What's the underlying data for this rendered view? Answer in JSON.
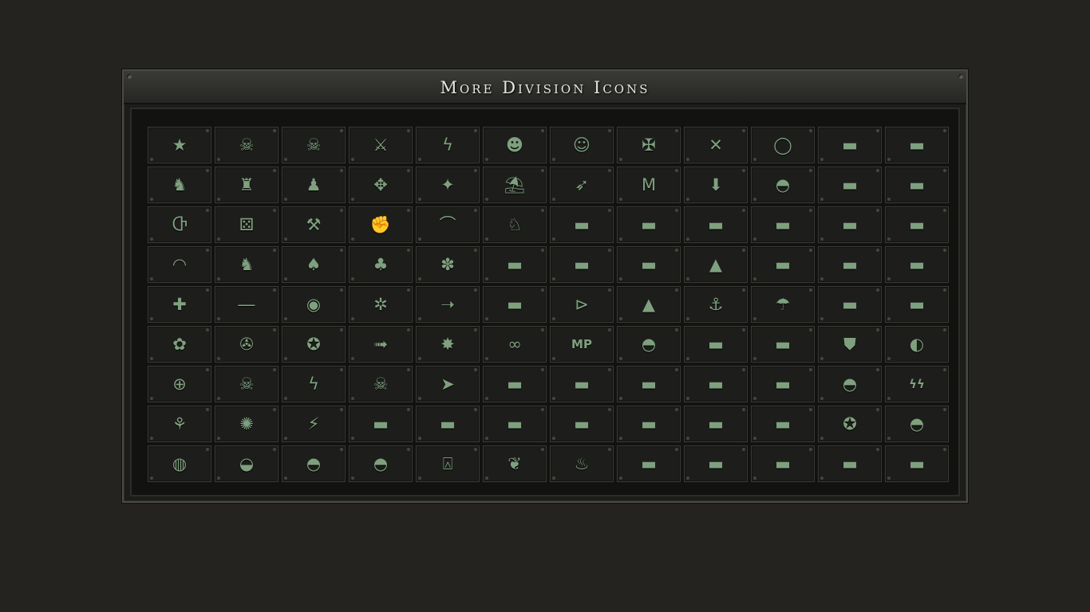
{
  "window": {
    "title": "More Division Icons"
  },
  "icons": [
    {
      "name": "star-icon",
      "g": "★"
    },
    {
      "name": "skull-icon",
      "g": "☠"
    },
    {
      "name": "winged-skull-icon",
      "g": "☠"
    },
    {
      "name": "crossed-rifles-icon",
      "g": "⚔"
    },
    {
      "name": "lightning-icon",
      "g": "ϟ"
    },
    {
      "name": "goblin-head-icon",
      "g": "☻"
    },
    {
      "name": "mask-icon",
      "g": "☺"
    },
    {
      "name": "winged-sword-icon",
      "g": "✠"
    },
    {
      "name": "crossed-swords-icon",
      "g": "✕"
    },
    {
      "name": "laurel-icon",
      "g": "◯"
    },
    {
      "name": "tank-icon",
      "g": "▬"
    },
    {
      "name": "tank-icon",
      "g": "▬"
    },
    {
      "name": "knight-piece-icon",
      "g": "♞"
    },
    {
      "name": "rook-piece-icon",
      "g": "♜"
    },
    {
      "name": "pawn-piece-icon",
      "g": "♟"
    },
    {
      "name": "compass-arrows-icon",
      "g": "✥"
    },
    {
      "name": "shuriken-star-icon",
      "g": "✦"
    },
    {
      "name": "palm-island-icon",
      "g": "⛱"
    },
    {
      "name": "bird-icon",
      "g": "➶"
    },
    {
      "name": "m-letter-icon",
      "g": "M"
    },
    {
      "name": "down-arrow-icon",
      "g": "⬇"
    },
    {
      "name": "helmet-icon",
      "g": "◓"
    },
    {
      "name": "heavy-tank-icon",
      "g": "▬"
    },
    {
      "name": "heavy-tank-icon",
      "g": "▬"
    },
    {
      "name": "rune-icon",
      "g": "Ⴇ"
    },
    {
      "name": "dice-icon",
      "g": "⚄"
    },
    {
      "name": "crossed-shovels-icon",
      "g": "⚒"
    },
    {
      "name": "fist-icon",
      "g": "✊"
    },
    {
      "name": "hook-icon",
      "g": "⌒"
    },
    {
      "name": "horse-icon",
      "g": "♘"
    },
    {
      "name": "truck-icon",
      "g": "▬"
    },
    {
      "name": "armored-car-icon",
      "g": "▬"
    },
    {
      "name": "light-tank-icon",
      "g": "▬"
    },
    {
      "name": "light-tank-icon",
      "g": "▬"
    },
    {
      "name": "heavy-tank-icon",
      "g": "▬"
    },
    {
      "name": "tank-icon",
      "g": "▬"
    },
    {
      "name": "rainbow-icon",
      "g": "◠"
    },
    {
      "name": "unicorn-icon",
      "g": "♞"
    },
    {
      "name": "spade-icon",
      "g": "♠"
    },
    {
      "name": "clover-icon",
      "g": "♣"
    },
    {
      "name": "paw-icon",
      "g": "✽"
    },
    {
      "name": "tank-icon",
      "g": "▬"
    },
    {
      "name": "heavy-tank-icon",
      "g": "▬"
    },
    {
      "name": "tank-icon",
      "g": "▬"
    },
    {
      "name": "anti-air-icon",
      "g": "▲"
    },
    {
      "name": "artillery-icon",
      "g": "▬"
    },
    {
      "name": "tank-icon",
      "g": "▬"
    },
    {
      "name": "tank-icon",
      "g": "▬"
    },
    {
      "name": "eagle-icon",
      "g": "✚"
    },
    {
      "name": "sword-icon",
      "g": "―"
    },
    {
      "name": "cat-head-icon",
      "g": "◉"
    },
    {
      "name": "wheel-icon",
      "g": "✲"
    },
    {
      "name": "arrow-icon",
      "g": "➝"
    },
    {
      "name": "field-gun-icon",
      "g": "▬"
    },
    {
      "name": "shovel-icon",
      "g": "⊳"
    },
    {
      "name": "mountains-icon",
      "g": "▲"
    },
    {
      "name": "anchor-icon",
      "g": "⚓"
    },
    {
      "name": "parachute-icon",
      "g": "☂"
    },
    {
      "name": "rocket-launcher-icon",
      "g": "▬"
    },
    {
      "name": "towed-gun-icon",
      "g": "▬"
    },
    {
      "name": "flower-icon",
      "g": "✿"
    },
    {
      "name": "eagle-head-icon",
      "g": "✇"
    },
    {
      "name": "wolf-head-icon",
      "g": "✪"
    },
    {
      "name": "bullet-icon",
      "g": "➟"
    },
    {
      "name": "explosion-icon",
      "g": "✸"
    },
    {
      "name": "binoculars-icon",
      "g": "∞"
    },
    {
      "name": "military-police-icon",
      "g": "MP"
    },
    {
      "name": "pith-helmet-icon",
      "g": "◓"
    },
    {
      "name": "tank-destroyer-icon",
      "g": "▬"
    },
    {
      "name": "tank-icon",
      "g": "▬"
    },
    {
      "name": "shield-icon",
      "g": "⛊"
    },
    {
      "name": "wave-icon",
      "g": "◐"
    },
    {
      "name": "crosshair-icon",
      "g": "⊕"
    },
    {
      "name": "skull-tank-icon",
      "g": "☠"
    },
    {
      "name": "lightning-tank-icon",
      "g": "ϟ"
    },
    {
      "name": "helmet-skull-icon",
      "g": "☠"
    },
    {
      "name": "shark-icon",
      "g": "➤"
    },
    {
      "name": "tank-icon",
      "g": "▬"
    },
    {
      "name": "self-propelled-gun-icon",
      "g": "▬"
    },
    {
      "name": "tank-icon",
      "g": "▬"
    },
    {
      "name": "tank-icon",
      "g": "▬"
    },
    {
      "name": "heavy-tank-icon",
      "g": "▬"
    },
    {
      "name": "helmet-icon",
      "g": "◓"
    },
    {
      "name": "ss-runes-icon",
      "g": "ϟϟ"
    },
    {
      "name": "palm-tree-icon",
      "g": "⚘"
    },
    {
      "name": "burst-icon",
      "g": "✺"
    },
    {
      "name": "claw-icon",
      "g": "⚡"
    },
    {
      "name": "tank-icon",
      "g": "▬"
    },
    {
      "name": "tank-icon",
      "g": "▬"
    },
    {
      "name": "tank-icon",
      "g": "▬"
    },
    {
      "name": "tank-icon",
      "g": "▬"
    },
    {
      "name": "tank-icon",
      "g": "▬"
    },
    {
      "name": "heavy-tank-icon",
      "g": "▬"
    },
    {
      "name": "heavy-tank-icon",
      "g": "▬"
    },
    {
      "name": "panther-head-icon",
      "g": "✪"
    },
    {
      "name": "turtle-icon",
      "g": "◓"
    },
    {
      "name": "globe-anchor-icon",
      "g": "◍"
    },
    {
      "name": "cap-icon",
      "g": "◒"
    },
    {
      "name": "stahlhelm-icon",
      "g": "◓"
    },
    {
      "name": "brodie-helmet-icon",
      "g": "◓"
    },
    {
      "name": "pickelhaube-icon",
      "g": "⍓"
    },
    {
      "name": "feather-icon",
      "g": "❦"
    },
    {
      "name": "flame-icon",
      "g": "♨"
    },
    {
      "name": "tank-icon",
      "g": "▬"
    },
    {
      "name": "tank-icon",
      "g": "▬"
    },
    {
      "name": "tank-icon",
      "g": "▬"
    },
    {
      "name": "armored-car-icon",
      "g": "▬"
    },
    {
      "name": "tank-icon",
      "g": "▬"
    }
  ]
}
